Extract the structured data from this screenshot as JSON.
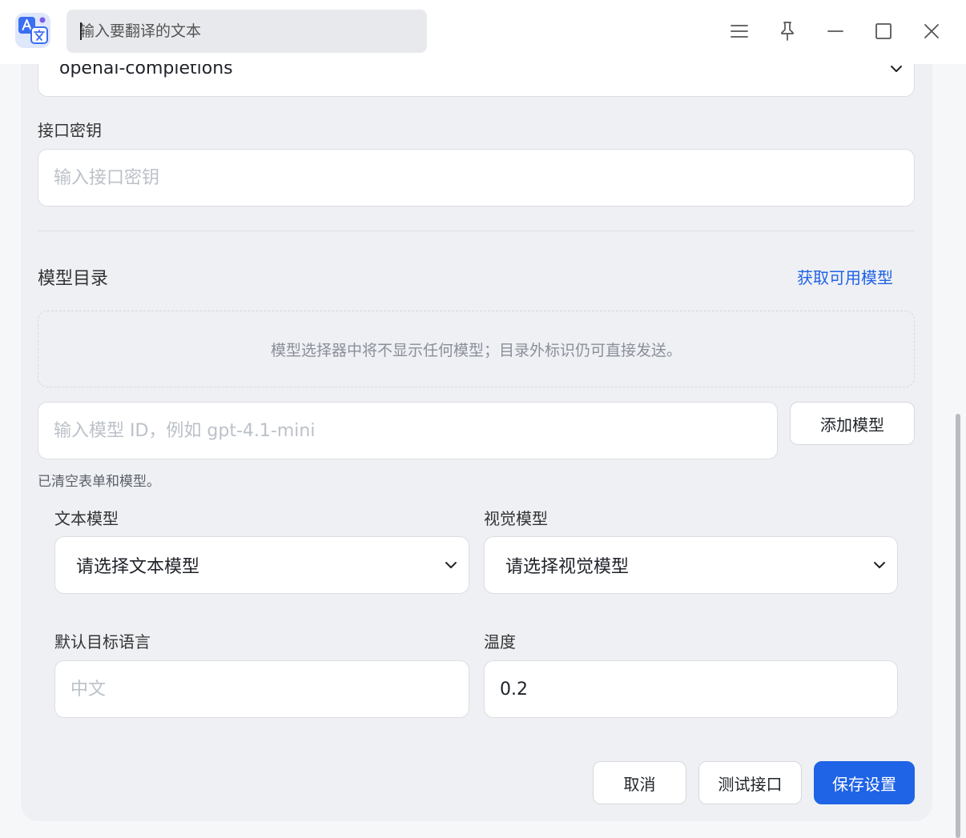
{
  "titlebar": {
    "search_placeholder": "输入要翻译的文本",
    "icons": [
      "menu-icon",
      "pin-icon",
      "minimize-icon",
      "maximize-icon",
      "close-icon"
    ]
  },
  "form": {
    "provider_select": {
      "value": "openai-completions"
    },
    "api_key": {
      "label": "接口密钥",
      "placeholder": "输入接口密钥",
      "value": ""
    },
    "model_catalog": {
      "title": "模型目录",
      "fetch_link": "获取可用模型",
      "empty_message": "模型选择器中将不显示任何模型；目录外标识仍可直接发送。",
      "model_id_placeholder": "输入模型 ID，例如 gpt-4.1-mini",
      "add_button": "添加模型",
      "status": "已清空表单和模型。"
    },
    "text_model": {
      "label": "文本模型",
      "value": "请选择文本模型"
    },
    "vision_model": {
      "label": "视觉模型",
      "value": "请选择视觉模型"
    },
    "default_language": {
      "label": "默认目标语言",
      "placeholder": "中文",
      "value": ""
    },
    "temperature": {
      "label": "温度",
      "value": "0.2"
    }
  },
  "actions": {
    "cancel": "取消",
    "test": "测试接口",
    "save": "保存设置"
  },
  "colors": {
    "accent": "#1f63e6",
    "card_bg": "#eff0f4",
    "page_bg": "#f6f7f9"
  }
}
